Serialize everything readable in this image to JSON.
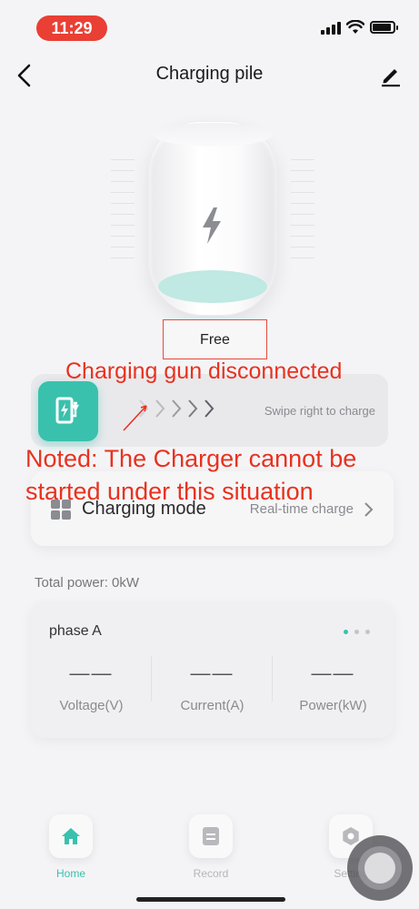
{
  "status_bar": {
    "time": "11:29"
  },
  "header": {
    "title": "Charging pile"
  },
  "charger": {
    "status": "Free"
  },
  "swipe": {
    "hint": "Swipe right to charge"
  },
  "mode": {
    "label": "Charging mode",
    "value": "Real-time charge"
  },
  "total_power": "Total power:  0kW",
  "phase": {
    "title": "phase A",
    "metrics": [
      {
        "value": "——",
        "label": "Voltage(V)"
      },
      {
        "value": "——",
        "label": "Current(A)"
      },
      {
        "value": "——",
        "label": "Power(kW)"
      }
    ]
  },
  "annotations": {
    "title": "Charging gun disconnected",
    "note": "Noted: The Charger cannot be started under this situation"
  },
  "nav": {
    "items": [
      {
        "label": "Home",
        "icon": "home-icon"
      },
      {
        "label": "Record",
        "icon": "record-icon"
      },
      {
        "label": "Setting",
        "icon": "settings-icon"
      }
    ]
  },
  "colors": {
    "accent": "#39c1ad",
    "annotation": "#e8321f",
    "time_pill": "#ea3f34"
  }
}
